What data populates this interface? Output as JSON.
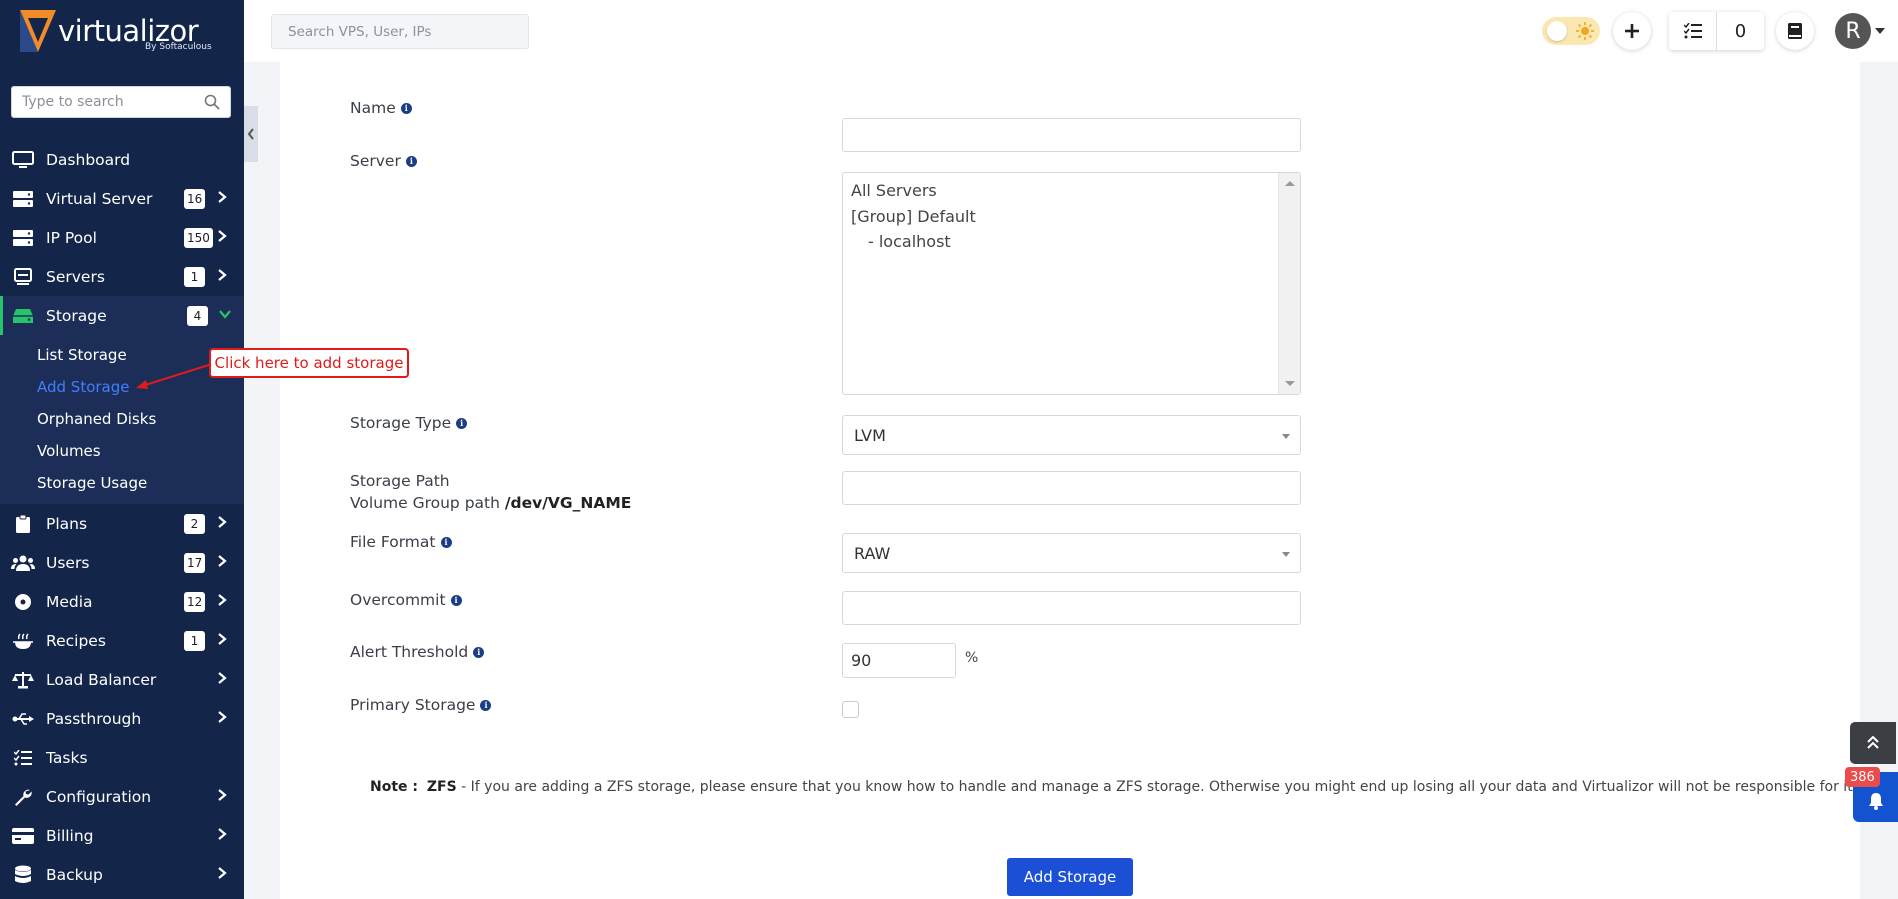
{
  "brand": {
    "name": "virtualizor",
    "subtitle": "By Softaculous"
  },
  "sidebar": {
    "search_placeholder": "Type to search",
    "items": [
      {
        "label": "Dashboard",
        "icon": "monitor-icon"
      },
      {
        "label": "Virtual Server",
        "icon": "server-stack-icon",
        "badge": "16"
      },
      {
        "label": "IP Pool",
        "icon": "server-stack-icon",
        "badge": "150"
      },
      {
        "label": "Servers",
        "icon": "server-icon",
        "badge": "1"
      },
      {
        "label": "Storage",
        "icon": "hard-drive-icon",
        "badge": "4",
        "expanded": true
      },
      {
        "label": "Plans",
        "icon": "clipboard-icon",
        "badge": "2"
      },
      {
        "label": "Users",
        "icon": "users-icon",
        "badge": "17"
      },
      {
        "label": "Media",
        "icon": "disc-icon",
        "badge": "12"
      },
      {
        "label": "Recipes",
        "icon": "chef-icon",
        "badge": "1"
      },
      {
        "label": "Load Balancer",
        "icon": "scale-icon"
      },
      {
        "label": "Passthrough",
        "icon": "usb-icon"
      },
      {
        "label": "Tasks",
        "icon": "list-icon"
      },
      {
        "label": "Configuration",
        "icon": "wrench-icon"
      },
      {
        "label": "Billing",
        "icon": "billing-icon"
      },
      {
        "label": "Backup",
        "icon": "database-icon"
      }
    ],
    "storage_submenu": [
      "List Storage",
      "Add Storage",
      "Orphaned Disks",
      "Volumes",
      "Storage Usage"
    ]
  },
  "topbar": {
    "search_placeholder": "Search VPS, User, IPs",
    "task_count": "0",
    "avatar_initial": "R"
  },
  "form": {
    "name_label": "Name",
    "server_label": "Server",
    "server_options": [
      "All Servers",
      "[Group] Default",
      "- localhost"
    ],
    "storage_type_label": "Storage Type",
    "storage_type_value": "LVM",
    "storage_path_label": "Storage Path",
    "volume_group_prefix": "Volume Group path",
    "volume_group_path": "/dev/VG_NAME",
    "file_format_label": "File Format",
    "file_format_value": "RAW",
    "overcommit_label": "Overcommit",
    "alert_threshold_label": "Alert Threshold",
    "alert_threshold_value": "90",
    "percent_symbol": "%",
    "primary_storage_label": "Primary Storage",
    "note_label": "Note :",
    "note_zfs": "ZFS",
    "note_text": " - If you are adding a ZFS storage, please ensure that you know how to handle and manage a ZFS storage. Otherwise you might end up losing all your data and Virtualizor will not be responsible for it !",
    "submit_label": "Add Storage"
  },
  "annotation": {
    "text": "Click here to add storage",
    "color": "#e01b1b"
  },
  "notifications": {
    "count": "386"
  },
  "colors": {
    "sidebar_bg": "#14254a",
    "accent_green": "#27c46b",
    "primary_blue": "#1a4fd6",
    "active_link": "#3f7fff"
  }
}
